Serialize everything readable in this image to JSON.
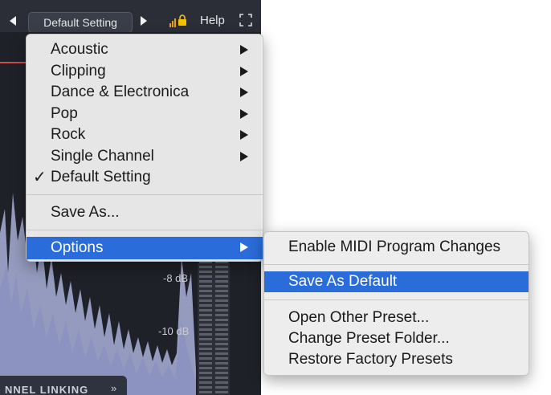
{
  "toolbar": {
    "preset_label": "Default Setting",
    "help_label": "Help"
  },
  "waveform": {
    "db_labels": [
      "-8 dB",
      "-10 dB"
    ]
  },
  "bottom_strip": {
    "label": "NNEL LINKING",
    "chevron": "»"
  },
  "main_menu": {
    "items": [
      {
        "label": "Acoustic",
        "submenu": true
      },
      {
        "label": "Clipping",
        "submenu": true
      },
      {
        "label": "Dance & Electronica",
        "submenu": true
      },
      {
        "label": "Pop",
        "submenu": true
      },
      {
        "label": "Rock",
        "submenu": true
      },
      {
        "label": "Single Channel",
        "submenu": true
      },
      {
        "label": "Default Setting",
        "checked": true,
        "check_glyph": "✓"
      },
      {
        "label": "Save As..."
      },
      {
        "label": "Options",
        "submenu": true,
        "highlighted": true
      }
    ]
  },
  "options_submenu": {
    "items": [
      {
        "label": "Enable MIDI Program Changes"
      },
      {
        "label": "Save As Default",
        "highlighted": true
      },
      {
        "label": "Open Other Preset..."
      },
      {
        "label": "Change Preset Folder..."
      },
      {
        "label": "Restore Factory Presets"
      }
    ]
  },
  "colors": {
    "highlight": "#2a6cd9",
    "plugin_bg": "#1f2128",
    "waveform_fill": "#aab0d8",
    "lock": "#f2c200",
    "signal": "#f2a000"
  }
}
